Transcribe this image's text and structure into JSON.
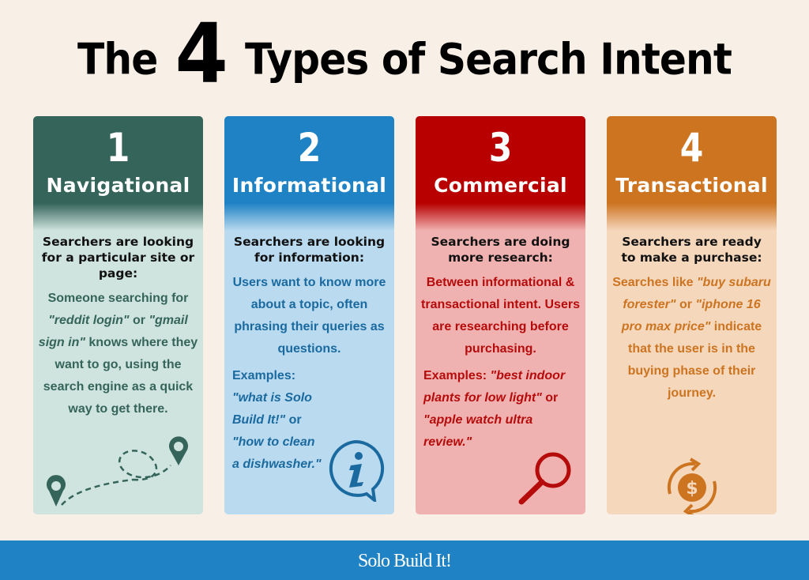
{
  "title": {
    "before": "The",
    "number": "4",
    "after": "Types of  Search Intent"
  },
  "colors": {
    "navigational": "#35645a",
    "informational": "#1f82c4",
    "commercial": "#b80000",
    "transactional": "#cd7420",
    "footer": "#1e82c4"
  },
  "cards": [
    {
      "number": "1",
      "name": "Navigational",
      "lead": "Searchers are looking for a particular site or page:",
      "body": [
        {
          "t": "Someone searching for ",
          "i": false
        },
        {
          "t": "\"reddit login\"",
          "i": true
        },
        {
          "t": " or ",
          "i": false
        },
        {
          "t": "\"gmail sign in\"",
          "i": true
        },
        {
          "t": " knows where they want to go, using the search engine as a quick way to get there.",
          "i": false
        }
      ],
      "icon": "map-route-pins-icon"
    },
    {
      "number": "2",
      "name": "Informational",
      "lead": "Searchers are looking for information:",
      "body": [
        {
          "t": "Users want to know more about a topic, often phrasing their queries as questions.",
          "i": false
        }
      ],
      "examples": [
        {
          "t": "Examples: ",
          "i": false
        },
        {
          "t": "\"what is Solo Build It!\"",
          "i": true
        },
        {
          "t": " or ",
          "i": false
        },
        {
          "t": "\"how to clean a dishwasher.\"",
          "i": true
        }
      ],
      "icon": "info-speech-bubble-icon"
    },
    {
      "number": "3",
      "name": "Commercial",
      "lead": "Searchers are doing more research:",
      "body": [
        {
          "t": "Between informational & transactional intent. Users are researching before purchasing.",
          "i": false
        }
      ],
      "examples": [
        {
          "t": "Examples: ",
          "i": false
        },
        {
          "t": "\"best indoor plants for low light\"",
          "i": true
        },
        {
          "t": " or ",
          "i": false
        },
        {
          "t": "\"apple watch ultra review.\"",
          "i": true
        }
      ],
      "icon": "magnifying-glass-icon"
    },
    {
      "number": "4",
      "name": "Transactional",
      "lead": "Searchers are ready to make a purchase:",
      "body": [
        {
          "t": "Searches like ",
          "i": false
        },
        {
          "t": "\"buy subaru forester\"",
          "i": true
        },
        {
          "t": " or ",
          "i": false
        },
        {
          "t": "\"iphone 16 pro max price\"",
          "i": true
        },
        {
          "t": " indicate that the user is in the buying phase of their journey.",
          "i": false
        }
      ],
      "icon": "dollar-cycle-icon"
    }
  ],
  "footer": {
    "brand": "Solo Build It!"
  }
}
